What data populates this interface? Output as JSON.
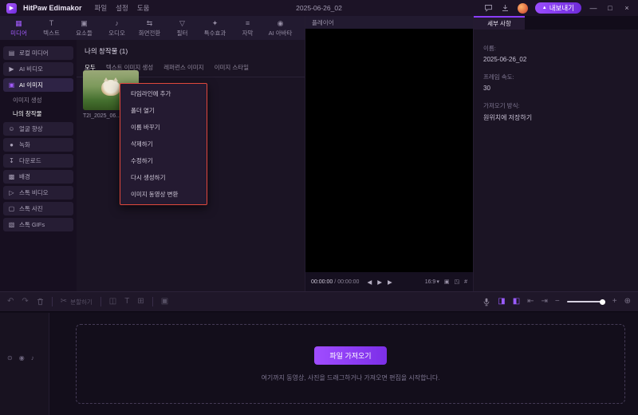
{
  "colors": {
    "accent": "#8b3dff",
    "annotation": "#e1483c"
  },
  "titlebar": {
    "app_name": "HitPaw Edimakor",
    "logo_glyph": "▶",
    "menu_items": [
      {
        "label": "파일"
      },
      {
        "label": "설정"
      },
      {
        "label": "도움"
      }
    ],
    "project_title": "2025-06-26_02",
    "export_label": "내보내기",
    "export_glyph": "▲",
    "window": {
      "minimize": "—",
      "maximize": "□",
      "close": "×"
    }
  },
  "media_tabs": {
    "items": [
      {
        "label": "미디어",
        "glyph": "▦"
      },
      {
        "label": "텍스트",
        "glyph": "T"
      },
      {
        "label": "요소들",
        "glyph": "▣"
      },
      {
        "label": "오디오",
        "glyph": "♪"
      },
      {
        "label": "화면전환",
        "glyph": "⇆"
      },
      {
        "label": "필터",
        "glyph": "▽"
      },
      {
        "label": "특수효과",
        "glyph": "✦"
      },
      {
        "label": "자막",
        "glyph": "≡"
      },
      {
        "label": "AI 아바타",
        "glyph": "◉"
      }
    ]
  },
  "sidebar": {
    "items": [
      {
        "label": "로컬 미디어",
        "glyph": "▤"
      },
      {
        "label": "AI 비디오",
        "glyph": "▶"
      },
      {
        "label": "AI 이미지",
        "glyph": "▣"
      },
      {
        "label": "이미지 생성"
      },
      {
        "label": "나의 창작물"
      },
      {
        "label": "얼굴 향상",
        "glyph": "☺"
      },
      {
        "label": "녹화",
        "glyph": "●"
      },
      {
        "label": "다운로드",
        "glyph": "↧"
      },
      {
        "label": "배경",
        "glyph": "▩"
      },
      {
        "label": "스톡 비디오",
        "glyph": "▷"
      },
      {
        "label": "스톡 사진",
        "glyph": "▢"
      },
      {
        "label": "스톡 GIFs",
        "glyph": "▧"
      }
    ]
  },
  "content": {
    "title": "나의 창작물 (1)",
    "filters": [
      {
        "label": "모두"
      },
      {
        "label": "텍스트 이미지 생성"
      },
      {
        "label": "레퍼런스 이미지"
      },
      {
        "label": "이미지 스타일"
      }
    ],
    "thumb_label": "T2I_2025_06..."
  },
  "context_menu": {
    "items": [
      {
        "label": "타임라인에 추가"
      },
      {
        "label": "폴더 열기"
      },
      {
        "label": "이름 바꾸기"
      },
      {
        "label": "삭제하기"
      },
      {
        "label": "수정하기"
      },
      {
        "label": "다시 생성하기"
      },
      {
        "label": "이미지 동영상 변환"
      }
    ]
  },
  "player": {
    "title": "플레이어",
    "time_current": "00:00:00",
    "time_divider": "/",
    "time_total": "00:00:00",
    "prev_glyph": "◀",
    "play_glyph": "▶",
    "next_glyph": "▶",
    "ratio": "16:9",
    "ratio_caret": "▾",
    "snapshot_glyph": "▣",
    "fullscreen_glyph": "◳",
    "grid_glyph": "#"
  },
  "details": {
    "tab": "세부 사항",
    "fields": [
      {
        "label": "이름:",
        "value": "2025-06-26_02"
      },
      {
        "label": "프레임 속도:",
        "value": "30"
      },
      {
        "label": "가져오기 방식:",
        "value": "원위치에 저장하기"
      }
    ]
  },
  "toolbar": {
    "undo_glyph": "↶",
    "redo_glyph": "↷",
    "split_glyph": "✂",
    "split_label": "분할하기",
    "crop_glyph": "◫",
    "text_glyph": "T",
    "keyframe_glyph": "⊞",
    "snapshot_glyph": "▣",
    "voice_glyph": "◨",
    "ripple_glyph": "◧",
    "jump_start_glyph": "⇤",
    "jump_end_glyph": "⇥",
    "zoom_out_glyph": "−",
    "zoom_in_glyph": "+",
    "fit_glyph": "⊕"
  },
  "timeline": {
    "record_glyph": "⊙",
    "eye_glyph": "◉",
    "mute_glyph": "♪",
    "import_label": "파일 가져오기",
    "hint": "여기까지 동영상, 사진을 드래그하거나 가져오면 편집을 시작합니다."
  }
}
